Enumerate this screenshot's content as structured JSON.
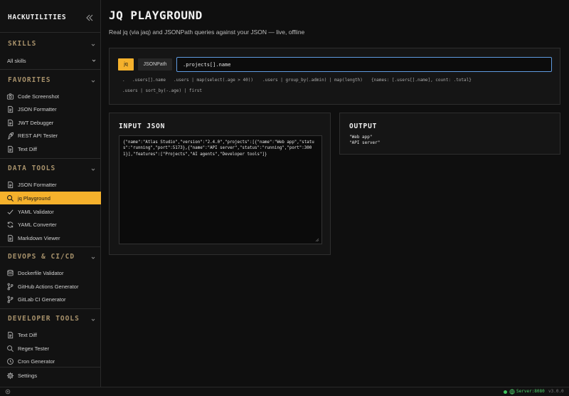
{
  "app": {
    "brand": "HACKUTILITIES"
  },
  "sidebar": {
    "skills": {
      "title": "SKILLS",
      "all": "All skills"
    },
    "favorites": {
      "title": "FAVORITES",
      "items": [
        {
          "label": "Code Screenshot",
          "icon": "camera-icon"
        },
        {
          "label": "JSON Formatter",
          "icon": "file-icon"
        },
        {
          "label": "JWT Debugger",
          "icon": "file-icon"
        },
        {
          "label": "REST API Tester",
          "icon": "rocket-icon"
        },
        {
          "label": "Text Diff",
          "icon": "file-icon"
        }
      ]
    },
    "data_tools": {
      "title": "DATA TOOLS",
      "items": [
        {
          "label": "JSON Formatter",
          "icon": "file-icon"
        },
        {
          "label": "jq Playground",
          "icon": "search-icon",
          "active": true
        },
        {
          "label": "YAML Validator",
          "icon": "check-icon"
        },
        {
          "label": "YAML Converter",
          "icon": "refresh-icon"
        },
        {
          "label": "Markdown Viewer",
          "icon": "file-icon"
        }
      ]
    },
    "devops": {
      "title": "DEVOPS & CI/CD",
      "items": [
        {
          "label": "Dockerfile Validator",
          "icon": "database-icon"
        },
        {
          "label": "GitHub Actions Generator",
          "icon": "git-branch-icon"
        },
        {
          "label": "GitLab CI Generator",
          "icon": "git-branch-icon"
        }
      ]
    },
    "developer_tools": {
      "title": "DEVELOPER TOOLS",
      "items": [
        {
          "label": "Text Diff",
          "icon": "file-icon"
        },
        {
          "label": "Regex Tester",
          "icon": "search-icon"
        },
        {
          "label": "Cron Generator",
          "icon": "clock-icon"
        }
      ]
    },
    "settings": "Settings"
  },
  "main": {
    "title": "JQ PLAYGROUND",
    "subtitle": "Real jq (via jaq) and JSONPath queries against your JSON — live, offline",
    "modes": {
      "jq": "jq",
      "jsonpath": "JSONPath"
    },
    "query": ".projects[].name",
    "examples": [
      ".",
      ".users[].name",
      ".users | map(select(.age > 40))",
      ".users | group_by(.admin) | map(length)",
      "{names: [.users[].name], count: .total}",
      ".users | sort_by(-.age) | first"
    ],
    "input": {
      "title": "INPUT JSON",
      "value": "{\"name\":\"Atlas Studio\",\"version\":\"2.4.0\",\"projects\":[{\"name\":\"Web app\",\"status\":\"running\",\"port\":5173},{\"name\":\"API server\",\"status\":\"running\",\"port\":3001}],\"features\":[\"Projects\",\"AI agents\",\"Developer tools\"]}"
    },
    "output": {
      "title": "OUTPUT",
      "lines": [
        "\"Web app\"",
        "\"API server\""
      ]
    }
  },
  "status": {
    "server": "Server:8080",
    "version": "v3.0.0"
  },
  "colors": {
    "accent": "#f5b12c",
    "section": "#a8926b",
    "focus": "#5f9be0",
    "server": "#4fd06a"
  }
}
